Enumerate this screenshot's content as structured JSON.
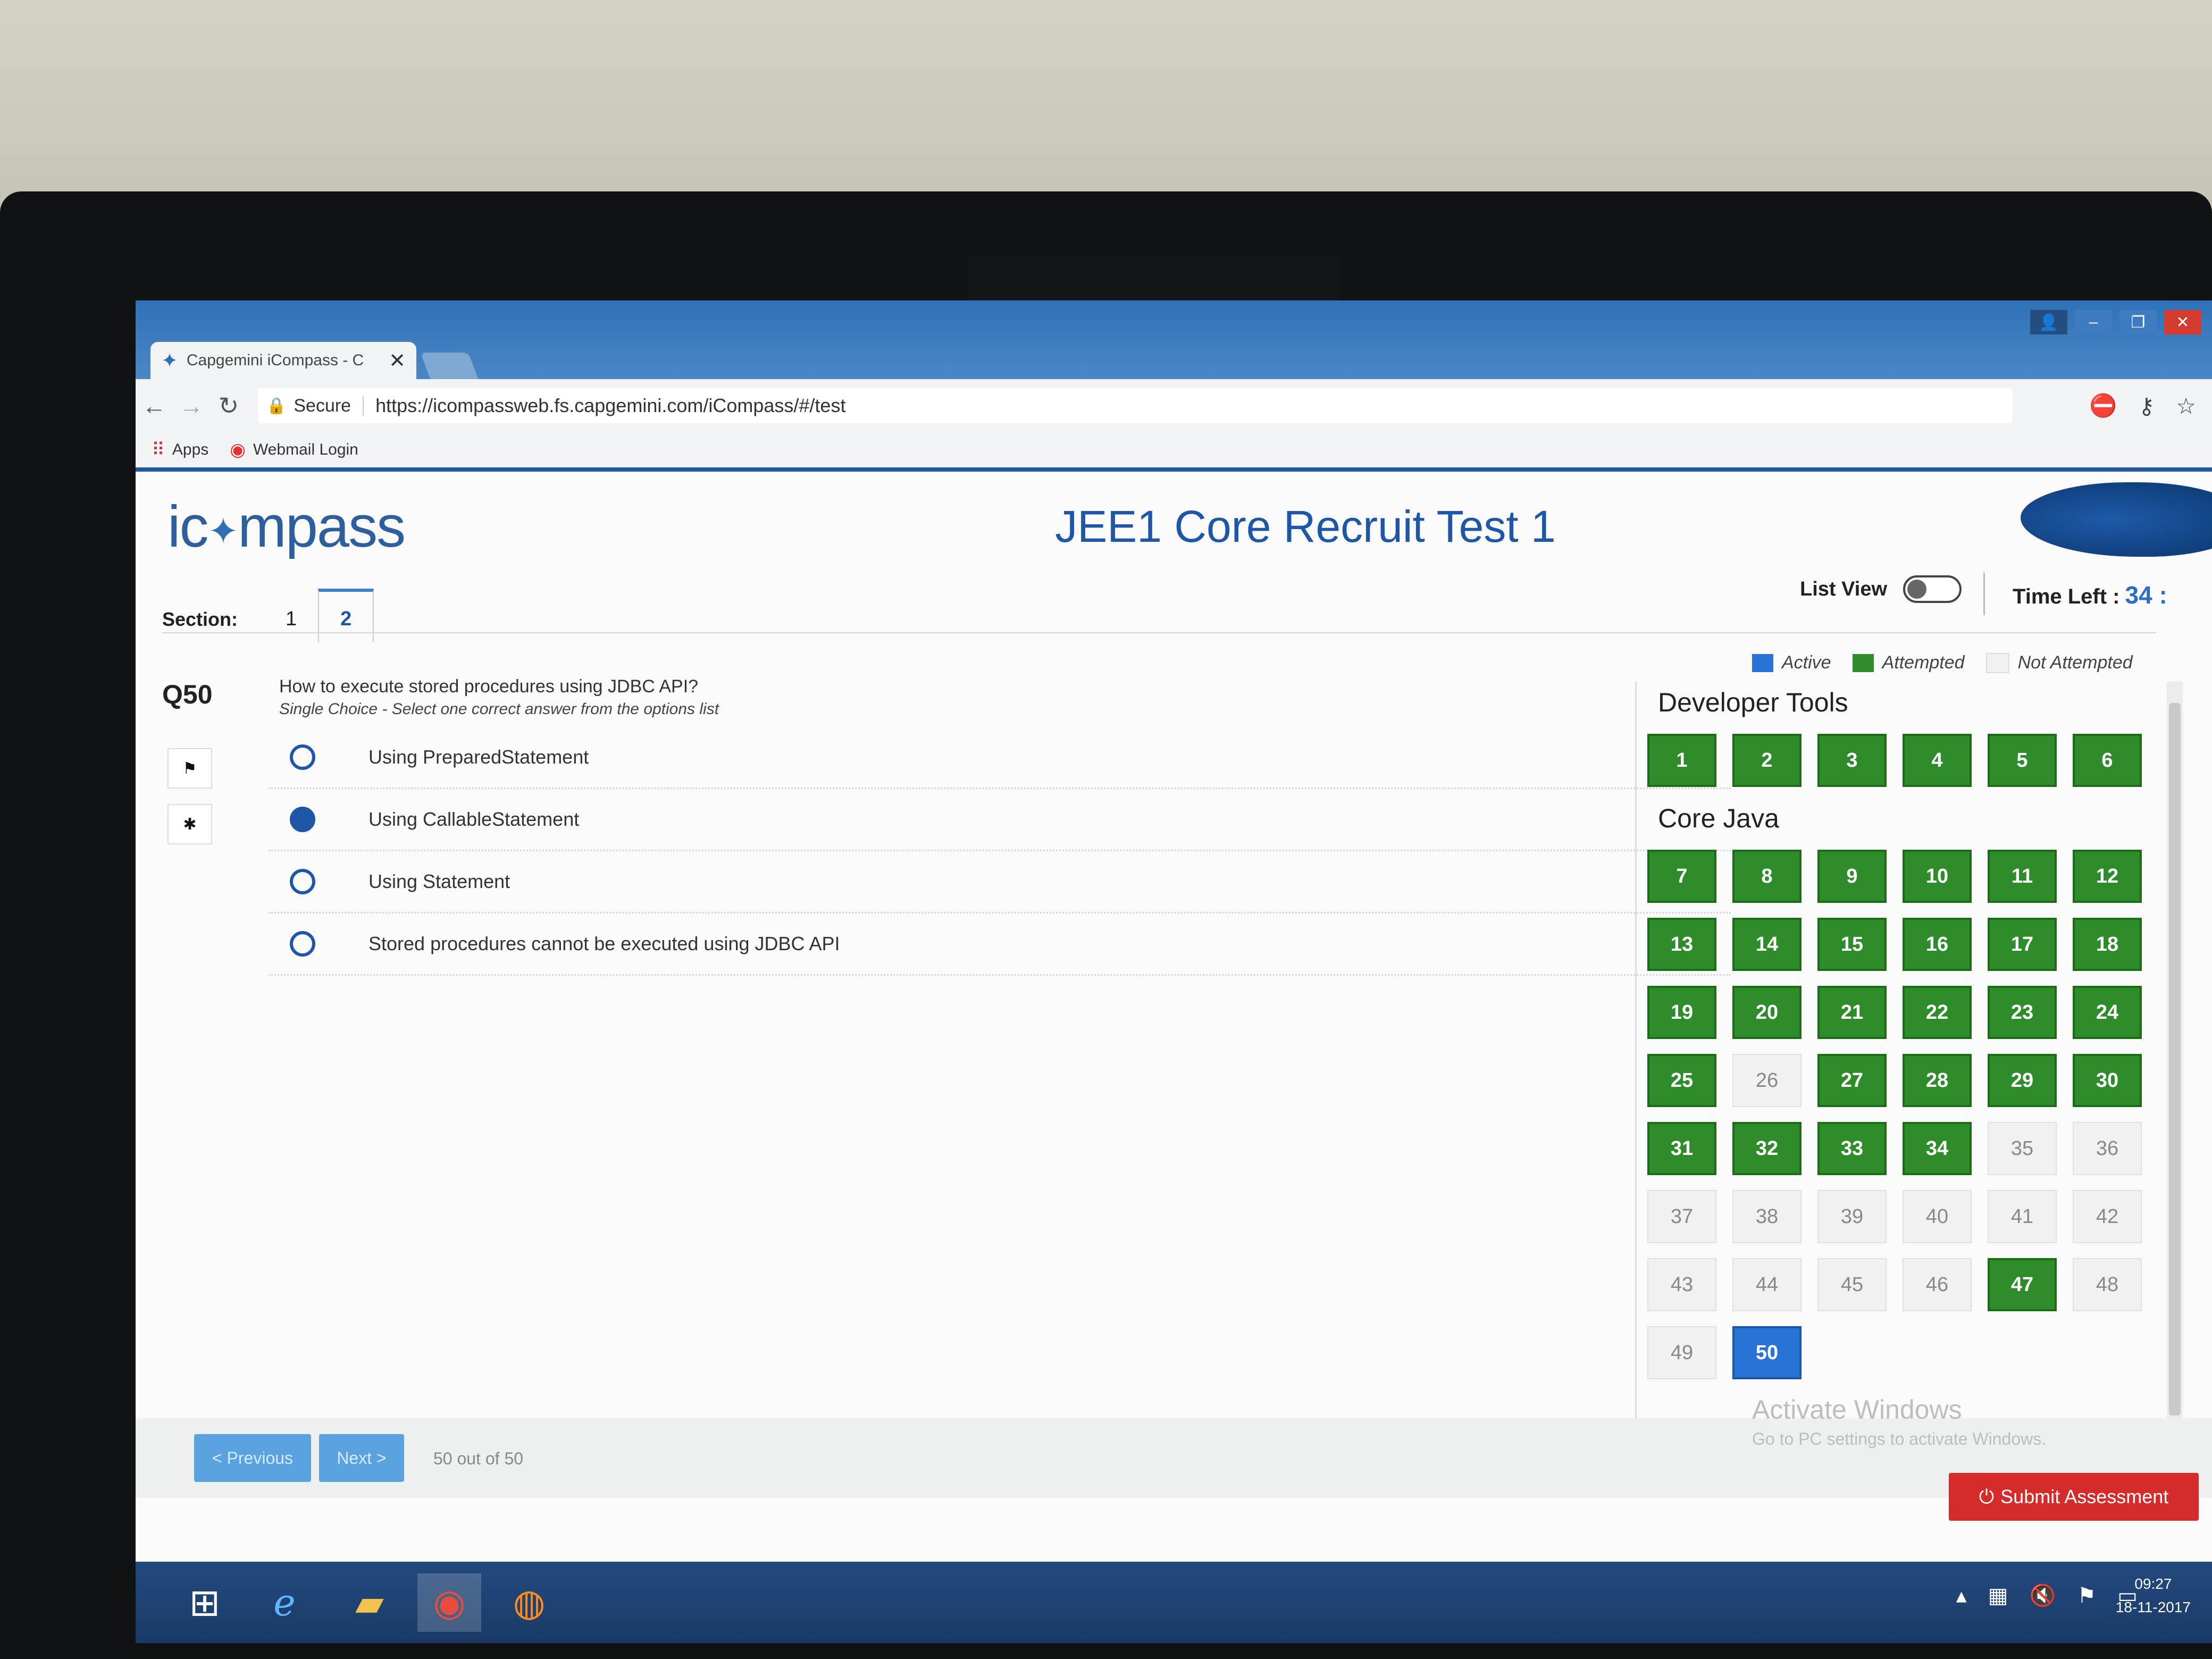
{
  "browser": {
    "tab_title": "Capgemini iCompass - C",
    "tab_close": "✕",
    "secure_label": "Secure",
    "url": "https://icompassweb.fs.capgemini.com/iCompass/#/test",
    "bookmarks": [
      {
        "label": "Apps",
        "icon": "apps-grid-icon"
      },
      {
        "label": "Webmail Login",
        "icon": "mail-logo-icon"
      }
    ]
  },
  "header": {
    "logo_prefix": "ic",
    "logo_suffix": "mpass",
    "title": "JEE1 Core Recruit Test 1",
    "section_label": "Section:",
    "sections": [
      "1",
      "2"
    ],
    "active_section": "2",
    "list_view_label": "List View",
    "list_view_on": false,
    "time_left_label": "Time Left :",
    "time_left_value": "34 :"
  },
  "legend": {
    "active": "Active",
    "attempted": "Attempted",
    "not_attempted": "Not Attempted"
  },
  "colors": {
    "active": "#2a73d6",
    "attempted": "#2f8c2a",
    "not_attempted": "#f1f1f1",
    "brand_blue": "#1f57a8",
    "submit_red": "#d62b2b"
  },
  "question": {
    "number": "Q50",
    "text": "How to execute stored procedures using JDBC API?",
    "subtext": "Single Choice - Select one correct answer from the options list",
    "options": [
      {
        "label": "Using PreparedStatement",
        "selected": false
      },
      {
        "label": "Using CallableStatement",
        "selected": true
      },
      {
        "label": "Using Statement",
        "selected": false
      },
      {
        "label": "Stored procedures cannot be executed using JDBC API",
        "selected": false
      }
    ]
  },
  "palette": {
    "groups": [
      {
        "title": "Developer Tools",
        "questions": [
          {
            "n": "1",
            "s": "attempted"
          },
          {
            "n": "2",
            "s": "attempted"
          },
          {
            "n": "3",
            "s": "attempted"
          },
          {
            "n": "4",
            "s": "attempted"
          },
          {
            "n": "5",
            "s": "attempted"
          },
          {
            "n": "6",
            "s": "attempted"
          }
        ]
      },
      {
        "title": "Core Java",
        "questions": [
          {
            "n": "7",
            "s": "attempted"
          },
          {
            "n": "8",
            "s": "attempted"
          },
          {
            "n": "9",
            "s": "attempted"
          },
          {
            "n": "10",
            "s": "attempted"
          },
          {
            "n": "11",
            "s": "attempted"
          },
          {
            "n": "12",
            "s": "attempted"
          },
          {
            "n": "13",
            "s": "attempted"
          },
          {
            "n": "14",
            "s": "attempted"
          },
          {
            "n": "15",
            "s": "attempted"
          },
          {
            "n": "16",
            "s": "attempted"
          },
          {
            "n": "17",
            "s": "attempted"
          },
          {
            "n": "18",
            "s": "attempted"
          },
          {
            "n": "19",
            "s": "attempted"
          },
          {
            "n": "20",
            "s": "attempted"
          },
          {
            "n": "21",
            "s": "attempted"
          },
          {
            "n": "22",
            "s": "attempted"
          },
          {
            "n": "23",
            "s": "attempted"
          },
          {
            "n": "24",
            "s": "attempted"
          },
          {
            "n": "25",
            "s": "attempted"
          },
          {
            "n": "26",
            "s": "not"
          },
          {
            "n": "27",
            "s": "attempted"
          },
          {
            "n": "28",
            "s": "attempted"
          },
          {
            "n": "29",
            "s": "attempted"
          },
          {
            "n": "30",
            "s": "attempted"
          },
          {
            "n": "31",
            "s": "attempted"
          },
          {
            "n": "32",
            "s": "attempted"
          },
          {
            "n": "33",
            "s": "attempted"
          },
          {
            "n": "34",
            "s": "attempted"
          },
          {
            "n": "35",
            "s": "not"
          },
          {
            "n": "36",
            "s": "not"
          },
          {
            "n": "37",
            "s": "not"
          },
          {
            "n": "38",
            "s": "not"
          },
          {
            "n": "39",
            "s": "not"
          },
          {
            "n": "40",
            "s": "not"
          },
          {
            "n": "41",
            "s": "not"
          },
          {
            "n": "42",
            "s": "not"
          },
          {
            "n": "43",
            "s": "not"
          },
          {
            "n": "44",
            "s": "not"
          },
          {
            "n": "45",
            "s": "not"
          },
          {
            "n": "46",
            "s": "not"
          },
          {
            "n": "47",
            "s": "attempted"
          },
          {
            "n": "48",
            "s": "not"
          },
          {
            "n": "49",
            "s": "not"
          },
          {
            "n": "50",
            "s": "active"
          }
        ]
      }
    ]
  },
  "footer": {
    "previous_label": "< Previous",
    "next_label": "Next >",
    "counter": "50 out of 50",
    "submit_label": "Submit Assessment",
    "activate_title": "Activate Windows",
    "activate_sub": "Go to PC settings to activate Windows."
  },
  "taskbar": {
    "time": "09:27",
    "date": "18-11-2017"
  }
}
